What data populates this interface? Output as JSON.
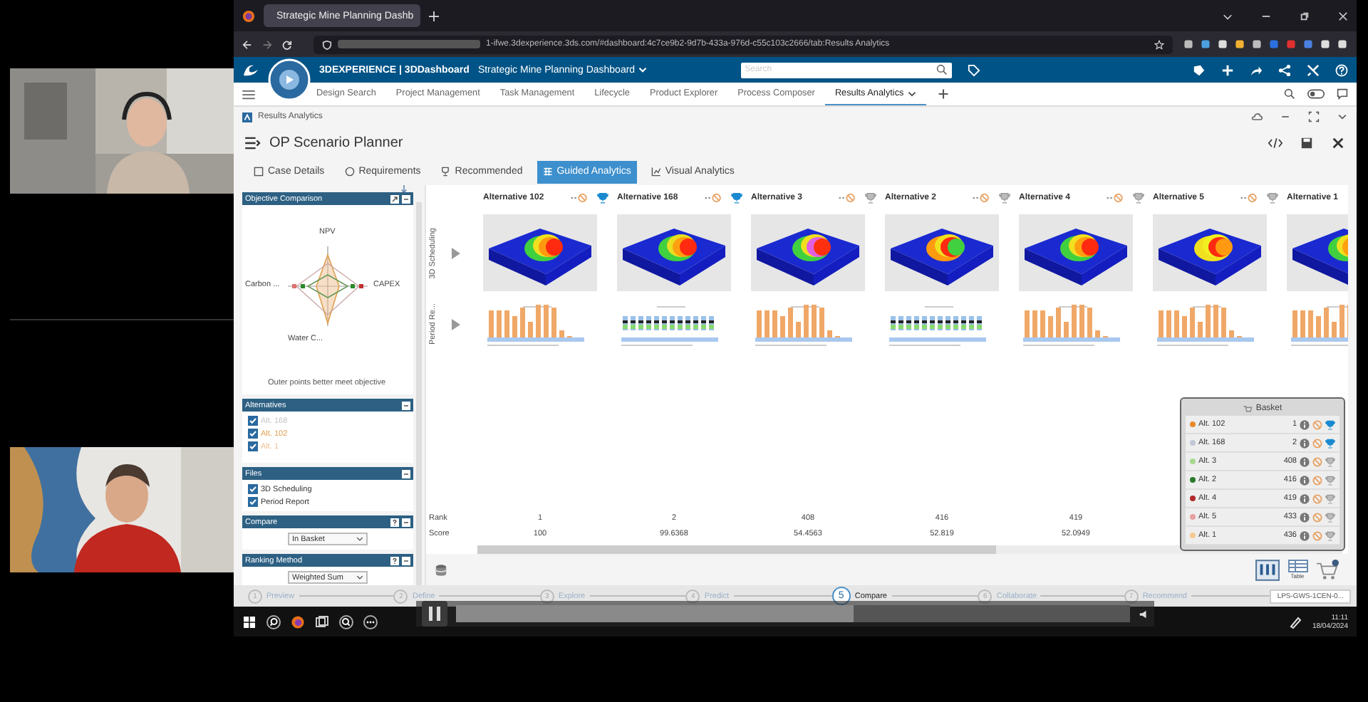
{
  "browser": {
    "tab_title": "Strategic Mine Planning Dashb",
    "url": "1-ifwe.3dexperience.3ds.com/#dashboard:4c7ce9b2-9d7b-433a-976d-c55c103c2666/tab:Results Analytics"
  },
  "app_bar": {
    "brand": "3DEXPERIENCE | 3DDashboard",
    "dashboard": "Strategic Mine Planning Dashboard",
    "search": {
      "placeholder": "Search"
    }
  },
  "dashboard_tabs": [
    {
      "label": "Design Search",
      "selected": false
    },
    {
      "label": "Project Management",
      "selected": false
    },
    {
      "label": "Task Management",
      "selected": false
    },
    {
      "label": "Lifecycle",
      "selected": false
    },
    {
      "label": "Product Explorer",
      "selected": false
    },
    {
      "label": "Process Composer",
      "selected": false
    },
    {
      "label": "Results Analytics",
      "selected": true
    }
  ],
  "widget": {
    "title": "Results Analytics"
  },
  "planner": {
    "title": "OP Scenario Planner",
    "tabs": [
      {
        "label": "Case Details",
        "selected": false
      },
      {
        "label": "Requirements",
        "selected": false
      },
      {
        "label": "Recommended",
        "selected": false
      },
      {
        "label": "Guided Analytics",
        "selected": true
      },
      {
        "label": "Visual Analytics",
        "selected": false
      }
    ]
  },
  "objective_comparison": {
    "title": "Objective Comparison",
    "axes": [
      "NPV",
      "CAPEX",
      "Water C...",
      "Carbon ..."
    ],
    "note": "Outer points better meet objective"
  },
  "alternatives_panel": {
    "title": "Alternatives",
    "items": [
      {
        "label": "Alt. 168",
        "checked": true,
        "color": "#c4c4c4"
      },
      {
        "label": "Alt. 102",
        "checked": true,
        "color": "#e0a050"
      },
      {
        "label": "Alt. 1",
        "checked": true,
        "color": "#f0c090"
      }
    ]
  },
  "files_panel": {
    "title": "Files",
    "items": [
      {
        "label": "3D Scheduling",
        "checked": true
      },
      {
        "label": "Period Report",
        "checked": true
      }
    ]
  },
  "compare_panel": {
    "title": "Compare",
    "select": "In Basket"
  },
  "ranking_panel": {
    "title": "Ranking Method",
    "select": "Weighted Sum"
  },
  "grid": {
    "row_labels": [
      "3D Scheduling",
      "Period Re..."
    ],
    "rank_label": "Rank",
    "score_label": "Score",
    "alternatives": [
      {
        "name": "Alternative 102",
        "recommended": true,
        "kind": "bars",
        "rank": "1",
        "score": "100"
      },
      {
        "name": "Alternative 168",
        "recommended": true,
        "kind": "dots",
        "rank": "2",
        "score": "99.6368"
      },
      {
        "name": "Alternative 3",
        "recommended": false,
        "kind": "bars",
        "rank": "408",
        "score": "54.4563"
      },
      {
        "name": "Alternative 2",
        "recommended": false,
        "kind": "dots",
        "rank": "416",
        "score": "52.819"
      },
      {
        "name": "Alternative 4",
        "recommended": false,
        "kind": "bars",
        "rank": "419",
        "score": "52.0949"
      },
      {
        "name": "Alternative 5",
        "recommended": false,
        "kind": "bars"
      },
      {
        "name": "Alternative 1",
        "kind": "bars"
      }
    ]
  },
  "basket": {
    "title": "Basket",
    "items": [
      {
        "label": "Alt. 102",
        "rank": "1",
        "color": "#e8892a",
        "recommended": true
      },
      {
        "label": "Alt. 168",
        "rank": "2",
        "color": "#c0c8d8",
        "recommended": true
      },
      {
        "label": "Alt. 3",
        "rank": "408",
        "color": "#a8d890",
        "recommended": false
      },
      {
        "label": "Alt. 2",
        "rank": "416",
        "color": "#2a7a2a",
        "recommended": false
      },
      {
        "label": "Alt. 4",
        "rank": "419",
        "color": "#b02a2a",
        "recommended": false
      },
      {
        "label": "Alt. 5",
        "rank": "433",
        "color": "#e8a0a0",
        "recommended": false
      },
      {
        "label": "Alt. 1",
        "rank": "436",
        "color": "#f5c890",
        "recommended": false
      }
    ]
  },
  "view_buttons": {
    "table_label": "Table"
  },
  "stepper": {
    "steps": [
      {
        "number": "1",
        "label": "Preview",
        "selected": false
      },
      {
        "number": "2",
        "label": "Define",
        "selected": false
      },
      {
        "number": "3",
        "label": "Explore",
        "selected": false
      },
      {
        "number": "4",
        "label": "Predict",
        "selected": false
      },
      {
        "number": "5",
        "label": "Compare",
        "selected": true
      },
      {
        "number": "6",
        "label": "Collaborate",
        "selected": false
      },
      {
        "number": "7",
        "label": "Recommend",
        "selected": false
      }
    ],
    "chip": "LPS-GWS-1CEN-0..."
  },
  "video": {
    "level": 0.59
  },
  "taskbar": {
    "time": "11:11",
    "date": "18/04/2024"
  }
}
